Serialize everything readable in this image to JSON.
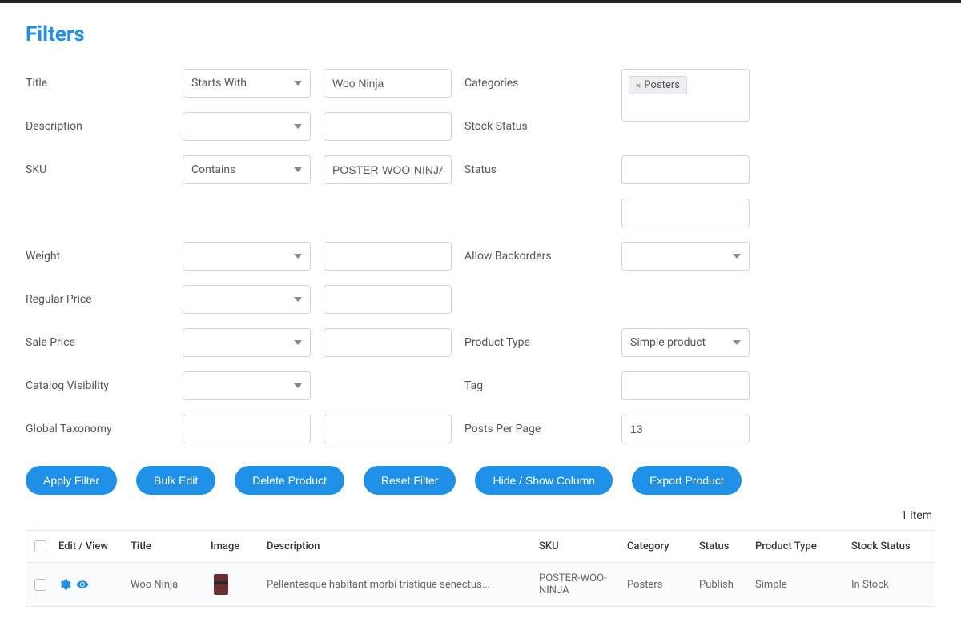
{
  "title": "Filters",
  "filters": {
    "title_label": "Title",
    "title_op": "Starts With",
    "title_val": "Woo Ninja",
    "categories_label": "Categories",
    "categories_tag": "Posters",
    "description_label": "Description",
    "stock_status_label": "Stock Status",
    "sku_label": "SKU",
    "sku_op": "Contains",
    "sku_val": "POSTER-WOO-NINJA",
    "status_label": "Status",
    "weight_label": "Weight",
    "backorders_label": "Allow Backorders",
    "regprice_label": "Regular Price",
    "saleprice_label": "Sale Price",
    "ptype_label": "Product Type",
    "ptype_val": "Simple product",
    "catalog_label": "Catalog Visibility",
    "tag_label": "Tag",
    "gtax_label": "Global Taxonomy",
    "ppp_label": "Posts Per Page",
    "ppp_val": "13"
  },
  "buttons": {
    "apply": "Apply Filter",
    "bulk": "Bulk Edit",
    "delete": "Delete Product",
    "reset": "Reset Filter",
    "hide": "Hide / Show Column",
    "export": "Export Product"
  },
  "count_text": "1 item",
  "headers": {
    "editview": "Edit / View",
    "title": "Title",
    "image": "Image",
    "description": "Description",
    "sku": "SKU",
    "category": "Category",
    "status": "Status",
    "ptype": "Product Type",
    "stock": "Stock Status"
  },
  "row": {
    "title": "Woo Ninja",
    "description": "Pellentesque habitant morbi tristique senectus...",
    "sku": "POSTER-WOO-NINJA",
    "category": "Posters",
    "status": "Publish",
    "ptype": "Simple",
    "stock": "In Stock"
  }
}
